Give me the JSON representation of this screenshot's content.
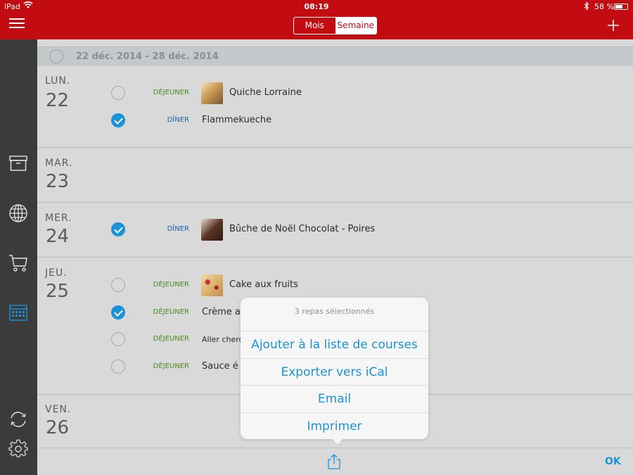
{
  "status": {
    "carrier": "iPad",
    "time": "08:19",
    "battery": "58 %"
  },
  "nav": {
    "tabs": [
      {
        "label": "Mois",
        "selected": false
      },
      {
        "label": "Semaine",
        "selected": true
      }
    ]
  },
  "colors": {
    "brand": "#c20c12",
    "accent": "#1a93d6",
    "lunch": "#4a8a20",
    "dinner": "#1a62a8"
  },
  "sidebar": {
    "items": [
      {
        "icon": "archive-icon"
      },
      {
        "icon": "globe-icon"
      },
      {
        "icon": "cart-icon"
      },
      {
        "icon": "calendar-icon",
        "active": true
      },
      {
        "icon": "sync-icon"
      },
      {
        "icon": "gear-icon"
      }
    ]
  },
  "week": {
    "range": "22 déc. 2014 - 28 déc. 2014"
  },
  "days": [
    {
      "name": "LUN.",
      "number": "22",
      "meals": [
        {
          "type": "DÉJEUNER",
          "kind": "lunch",
          "name": "Quiche Lorraine",
          "checked": false,
          "thumb": true
        },
        {
          "type": "DÎNER",
          "kind": "dinner",
          "name": "Flammekueche",
          "checked": true,
          "thumb": false
        }
      ]
    },
    {
      "name": "MAR.",
      "number": "23",
      "meals": []
    },
    {
      "name": "MER.",
      "number": "24",
      "meals": [
        {
          "type": "DÎNER",
          "kind": "dinner",
          "name": "Bûche de Noël Chocolat - Poires",
          "checked": true,
          "thumb": true
        }
      ]
    },
    {
      "name": "JEU.",
      "number": "25",
      "meals": [
        {
          "type": "DÉJEUNER",
          "kind": "lunch",
          "name": "Cake aux fruits",
          "checked": false,
          "thumb": true
        },
        {
          "type": "DÉJEUNER",
          "kind": "lunch",
          "name": "Crème a",
          "checked": true,
          "thumb": false
        },
        {
          "type": "DÉJEUNER",
          "kind": "lunch",
          "name": "Aller cherc",
          "checked": false,
          "thumb": false
        },
        {
          "type": "DÉJEUNER",
          "kind": "lunch",
          "name": "Sauce é",
          "checked": false,
          "thumb": false
        }
      ]
    },
    {
      "name": "VEN.",
      "number": "26",
      "meals": []
    }
  ],
  "popover": {
    "title": "3 repas sélectionnés",
    "options": [
      "Ajouter à la liste de courses",
      "Exporter vers iCal",
      "Email",
      "Imprimer"
    ]
  },
  "bottom": {
    "ok_label": "OK"
  }
}
